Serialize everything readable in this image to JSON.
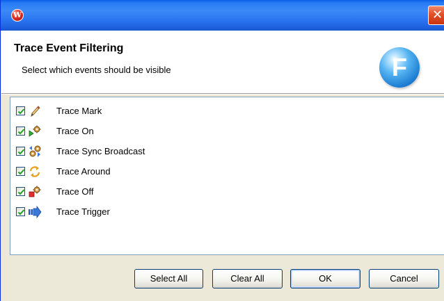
{
  "window": {
    "app_icon_glyph": "W",
    "close_glyph": "✕"
  },
  "header": {
    "title": "Trace Event Filtering",
    "subtitle": "Select which events should be visible",
    "logo_letter": "F"
  },
  "events": [
    {
      "label": "Trace Mark",
      "checked": true,
      "icon": "pencil-icon"
    },
    {
      "label": "Trace On",
      "checked": true,
      "icon": "trace-on-icon"
    },
    {
      "label": "Trace Sync Broadcast",
      "checked": true,
      "icon": "sync-broadcast-icon"
    },
    {
      "label": "Trace Around",
      "checked": true,
      "icon": "trace-around-icon"
    },
    {
      "label": "Trace Off",
      "checked": true,
      "icon": "trace-off-icon"
    },
    {
      "label": "Trace Trigger",
      "checked": true,
      "icon": "trigger-arrow-icon"
    }
  ],
  "buttons": {
    "select_all": "Select All",
    "clear_all": "Clear All",
    "ok": "OK",
    "cancel": "Cancel"
  },
  "colors": {
    "titlebar": "#2a75f0",
    "checkmark": "#21a121",
    "list_border": "#7f9db9",
    "button_border": "#003c74"
  }
}
